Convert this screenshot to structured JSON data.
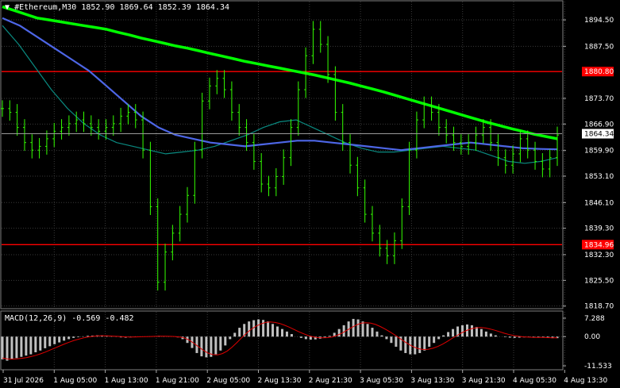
{
  "header": {
    "symbol": "#Ethereum,M30",
    "ohlc": "1852.90 1869.64 1852.39 1864.34"
  },
  "macd": {
    "label": "MACD(12,26,9) -0.569 -0.482",
    "scale_labels": [
      "7.288",
      "0.00",
      "-11.533"
    ],
    "scale_values": [
      7.288,
      0,
      -11.533
    ],
    "histogram": [
      -9,
      -9.5,
      -9,
      -8.5,
      -8,
      -7.5,
      -7,
      -6.2,
      -5.5,
      -4.6,
      -3.8,
      -3,
      -2.3,
      -1.6,
      -1,
      -0.5,
      -0.2,
      0.1,
      0.3,
      0.4,
      0.5,
      0.4,
      0.2,
      0.1,
      -0.1,
      -0.3,
      -0.4,
      -0.3,
      -0.2,
      -0.1,
      0,
      0.1,
      0.2,
      0.3,
      0.2,
      0.1,
      0,
      -0.3,
      -1,
      -2.5,
      -4.5,
      -6.5,
      -7.8,
      -8.2,
      -8,
      -7,
      -5.5,
      -3.5,
      -1,
      1.5,
      3.5,
      5,
      6,
      6.5,
      6.8,
      6.6,
      6,
      5,
      4,
      3,
      2,
      1,
      0,
      -0.5,
      -1,
      -1.2,
      -1.1,
      -0.8,
      -0.3,
      0.3,
      1.5,
      3,
      4.5,
      6,
      7,
      6.8,
      6,
      5,
      3.5,
      2,
      0.5,
      -1,
      -2.5,
      -4,
      -5.5,
      -6.5,
      -7,
      -7,
      -6.5,
      -5.5,
      -4,
      -2.5,
      -1,
      0.5,
      1.8,
      3,
      4,
      4.5,
      4.8,
      4.5,
      3.8,
      3,
      2,
      1.2,
      0.5,
      0,
      -0.2,
      -0.4,
      -0.5,
      -0.4,
      -0.3,
      -0.2,
      -0.2,
      -0.3,
      -0.4,
      -0.5,
      -0.6,
      -0.6
    ],
    "signal": [
      -8.5,
      -8.8,
      -8.9,
      -8.8,
      -8.6,
      -8.3,
      -7.9,
      -7.4,
      -6.8,
      -6.1,
      -5.3,
      -4.5,
      -3.7,
      -2.9,
      -2.2,
      -1.5,
      -1,
      -0.5,
      -0.1,
      0.1,
      0.3,
      0.35,
      0.3,
      0.2,
      0.1,
      0,
      -0.1,
      -0.15,
      -0.1,
      -0.05,
      0,
      0.05,
      0.1,
      0.15,
      0.15,
      0.1,
      0.05,
      -0.1,
      -0.5,
      -1.3,
      -2.6,
      -4,
      -5.4,
      -6.5,
      -7.1,
      -7.2,
      -6.7,
      -5.7,
      -4.2,
      -2.4,
      -0.5,
      1.3,
      2.9,
      4.1,
      5,
      5.6,
      5.8,
      5.6,
      5.2,
      4.5,
      3.7,
      2.8,
      1.9,
      1.1,
      0.4,
      -0.1,
      -0.4,
      -0.5,
      -0.4,
      -0.1,
      0.5,
      1.4,
      2.5,
      3.6,
      4.6,
      5.3,
      5.5,
      5.3,
      4.8,
      4,
      3,
      1.9,
      0.7,
      -0.6,
      -1.9,
      -3.1,
      -4.1,
      -4.8,
      -5.1,
      -5,
      -4.6,
      -3.9,
      -3,
      -1.9,
      -0.7,
      0.4,
      1.5,
      2.4,
      3.1,
      3.5,
      3.6,
      3.4,
      3,
      2.5,
      1.9,
      1.3,
      0.8,
      0.4,
      0.1,
      -0.1,
      -0.2,
      -0.3,
      -0.3,
      -0.35,
      -0.4,
      -0.45,
      -0.48
    ]
  },
  "price_axis": {
    "labels": [
      "1894.50",
      "1887.50",
      "1880.80",
      "1873.70",
      "1866.90",
      "1864.34",
      "1859.90",
      "1853.10",
      "1846.10",
      "1839.30",
      "1834.96",
      "1832.30",
      "1825.50",
      "1818.70"
    ],
    "ticks": [
      1894.5,
      1887.5,
      1873.7,
      1866.9,
      1859.9,
      1853.1,
      1846.1,
      1839.3,
      1832.3,
      1825.5,
      1818.7
    ],
    "current_price": 1864.34,
    "min": 1818.0,
    "max": 1898.5
  },
  "levels": [
    {
      "price": 1880.8,
      "label": "1880.80",
      "color": "#ff0000"
    },
    {
      "price": 1834.96,
      "label": "1834.96",
      "color": "#ff0000"
    }
  ],
  "time_axis": {
    "labels": [
      "31 Jul 2026",
      "1 Aug 05:00",
      "1 Aug 13:00",
      "1 Aug 21:00",
      "2 Aug 05:00",
      "2 Aug 13:30",
      "2 Aug 21:30",
      "3 Aug 05:30",
      "3 Aug 13:30",
      "3 Aug 21:30",
      "4 Aug 05:30",
      "4 Aug 13:30"
    ]
  },
  "chart_data": {
    "type": "line",
    "title": "",
    "series": [
      {
        "color": "#33ff00",
        "values": [
          1871,
          1870,
          1866,
          1862,
          1860,
          1861,
          1863,
          1865,
          1866,
          1867,
          1868,
          1867,
          1866,
          1865,
          1866,
          1867,
          1869,
          1870,
          1868,
          1860,
          1845,
          1825,
          1833,
          1838,
          1843,
          1848,
          1860,
          1873,
          1877,
          1879,
          1876,
          1870,
          1866,
          1862,
          1857,
          1851,
          1850,
          1853,
          1858,
          1866,
          1876,
          1885,
          1892,
          1888,
          1880,
          1870,
          1862,
          1856,
          1850,
          1843,
          1838,
          1834,
          1832,
          1836,
          1845,
          1860,
          1868,
          1872,
          1870,
          1866,
          1864,
          1862,
          1861,
          1862,
          1864,
          1866,
          1862,
          1858,
          1856,
          1859,
          1863,
          1860,
          1857,
          1855,
          1858,
          1864
        ]
      },
      {
        "color": "#00ff00",
        "values": [
          1898,
          1897,
          1896,
          1895,
          1894.5,
          1894,
          1893.5,
          1893,
          1892.5,
          1892,
          1891.2,
          1890.5,
          1889.7,
          1889,
          1888.3,
          1887.6,
          1887,
          1886.3,
          1885.6,
          1884.9,
          1884.2,
          1883.5,
          1882.9,
          1882.3,
          1881.7,
          1881.1,
          1880.5,
          1879.9,
          1879.2,
          1878.5,
          1877.8,
          1877,
          1876.2,
          1875.4,
          1874.5,
          1873.6,
          1872.7,
          1871.8,
          1870.9,
          1870,
          1869.1,
          1868.2,
          1867.3,
          1866.5,
          1865.7,
          1865,
          1864.2,
          1863.6,
          1863
        ]
      },
      {
        "color": "#4d66e6",
        "values": [
          1895,
          1893,
          1890,
          1887,
          1884,
          1881,
          1877,
          1873,
          1869,
          1866,
          1864,
          1863,
          1862,
          1861.5,
          1861,
          1861.5,
          1862,
          1862.5,
          1862.5,
          1862,
          1861.5,
          1861,
          1860.5,
          1860,
          1860.5,
          1861,
          1861.5,
          1862,
          1861.5,
          1861,
          1860.5,
          1860.3,
          1860.2
        ]
      },
      {
        "color": "#0a8a80",
        "values": [
          1893,
          1888,
          1882,
          1876,
          1871,
          1867,
          1864,
          1862,
          1861,
          1860,
          1859,
          1859.5,
          1860,
          1861,
          1862.5,
          1864,
          1866,
          1867.5,
          1868,
          1866,
          1864,
          1862,
          1860.5,
          1859.5,
          1859.5,
          1860,
          1860.5,
          1861,
          1860.5,
          1860,
          1858.5,
          1857,
          1856.5,
          1857,
          1858
        ]
      }
    ]
  }
}
